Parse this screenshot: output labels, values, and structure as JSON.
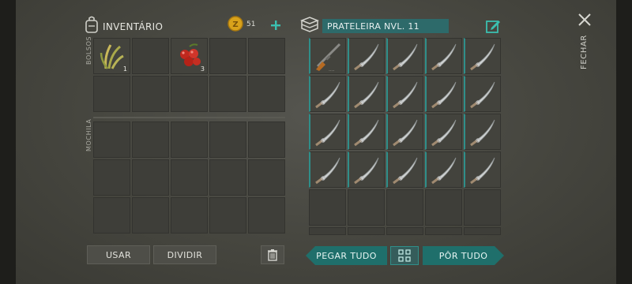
{
  "inventory": {
    "title": "INVENTÁRIO",
    "coins": "51",
    "pockets_label": "BOLSOS",
    "backpack_label": "MOCHILA",
    "pocket_slots": [
      {
        "item": "grass-plant",
        "qty": "1"
      },
      {
        "item": "",
        "qty": ""
      },
      {
        "item": "red-berries",
        "qty": "3"
      },
      {
        "item": "",
        "qty": ""
      },
      {
        "item": "",
        "qty": ""
      },
      {
        "item": "",
        "qty": ""
      },
      {
        "item": "",
        "qty": ""
      },
      {
        "item": "",
        "qty": ""
      },
      {
        "item": "",
        "qty": ""
      },
      {
        "item": "",
        "qty": ""
      }
    ],
    "backpack_slot_count": 15,
    "buttons": {
      "use": "USAR",
      "split": "DIVIDIR"
    }
  },
  "shelf": {
    "title": "PRATELEIRA NVL. 11",
    "slots": [
      "rifle",
      "machete",
      "machete",
      "machete",
      "machete",
      "machete",
      "machete",
      "machete",
      "machete",
      "machete",
      "machete",
      "machete",
      "machete",
      "machete",
      "machete",
      "machete",
      "machete",
      "machete",
      "machete",
      "machete",
      "",
      "",
      "",
      "",
      "",
      "",
      "",
      "",
      "",
      ""
    ],
    "buttons": {
      "take_all": "PEGAR TUDO",
      "put_all": "PÔR TUDO"
    }
  },
  "close_label": "FECHAR",
  "colors": {
    "accent": "#2f8f8a",
    "coin": "#d9a21b",
    "plus": "#3bbfb0"
  }
}
